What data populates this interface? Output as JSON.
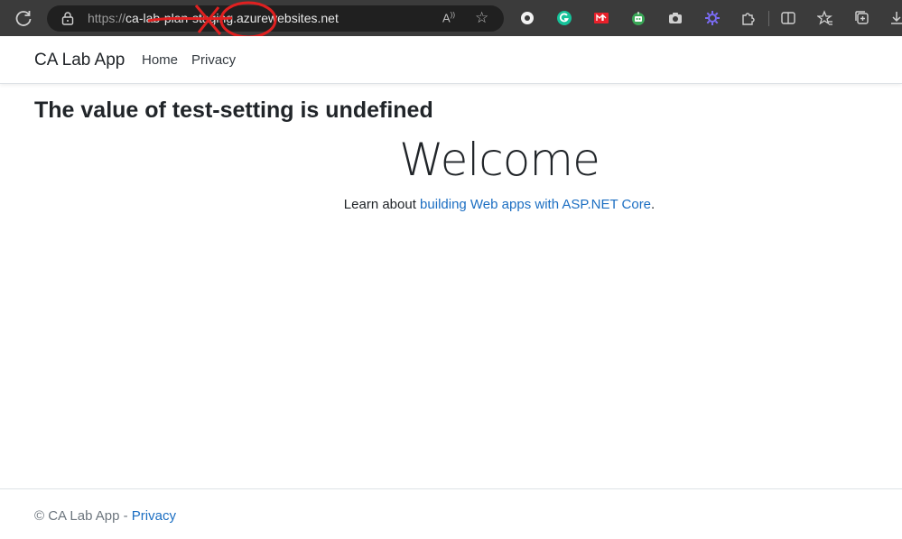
{
  "browser": {
    "url_scheme": "https://",
    "url_rest": "ca-lab-plan-staging.azurewebsites.net",
    "read_aloud_label": "A",
    "icons": [
      "reload-icon",
      "lock-icon",
      "read-aloud-icon",
      "favorite-star-icon",
      "extension-circle-icon",
      "grammarly-icon",
      "red-extension-icon",
      "green-robot-icon",
      "camera-icon",
      "purple-gear-icon",
      "extensions-puzzle-icon",
      "split-screen-icon",
      "favorites-icon",
      "collections-icon",
      "downloads-icon"
    ]
  },
  "navbar": {
    "brand": "CA Lab App",
    "links": [
      "Home",
      "Privacy"
    ]
  },
  "main": {
    "setting_heading": "The value of test-setting is undefined",
    "welcome": "Welcome",
    "learn_prefix": "Learn about ",
    "learn_link": "building Web apps with ASP.NET Core",
    "learn_suffix": "."
  },
  "footer": {
    "copyright": "© CA Lab App - ",
    "privacy_link": "Privacy"
  },
  "colors": {
    "link": "#1b6ec2",
    "chrome_bg": "#3b3b3b",
    "annotation": "#e02020"
  }
}
